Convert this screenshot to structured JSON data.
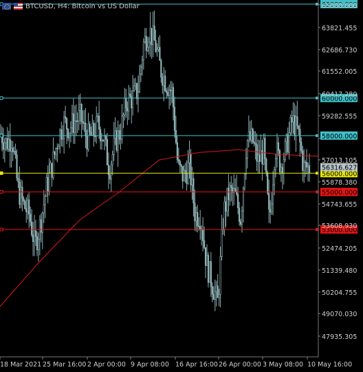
{
  "window": {
    "symbol_title": "BTCUSD, H4:  Bitcoin vs US Dollar",
    "icons": [
      "eu-flag-icon",
      "us-flag-icon"
    ]
  },
  "colors": {
    "background": "#000000",
    "candle": "#8fb2b5",
    "ma": "#d81a1a",
    "cyan_level": "#3fc1c9",
    "yellow_level": "#e8e800",
    "red_level": "#e61515",
    "price_label": "#b8c4c8",
    "axis_text": "#d0d0d0"
  },
  "chart_data": {
    "type": "candlestick",
    "title": "BTCUSD, H4:  Bitcoin vs US Dollar",
    "ylim": [
      46500,
      65000
    ],
    "y_ticks": [
      "65000.000",
      "63821.455",
      "62686.730",
      "61552.005",
      "60417.280",
      "59282.555",
      "58147.830",
      "57013.105",
      "55878.380",
      "54743.655",
      "53608.930",
      "52474.205",
      "51339.480",
      "50204.755",
      "49070.030",
      "47935.305"
    ],
    "x_ticks": [
      "18 Mar 2021",
      "25 Mar 16:00",
      "2 Apr 00:00",
      "9 Apr 08:00",
      "16 Apr 16:00",
      "26 Apr 00:00",
      "3 May 08:00",
      "10 May 16:00"
    ],
    "close_series": [
      {
        "x": "18 Mar 2021",
        "y": 58100
      },
      {
        "x": "19 Mar",
        "y": 57600
      },
      {
        "x": "20 Mar",
        "y": 57900
      },
      {
        "x": "22 Mar",
        "y": 55200
      },
      {
        "x": "23 Mar",
        "y": 54300
      },
      {
        "x": "24 Mar",
        "y": 53800
      },
      {
        "x": "25 Mar 16:00",
        "y": 52100
      },
      {
        "x": "26 Mar",
        "y": 53400
      },
      {
        "x": "27 Mar",
        "y": 55200
      },
      {
        "x": "28 Mar",
        "y": 56400
      },
      {
        "x": "29 Mar",
        "y": 57800
      },
      {
        "x": "30 Mar",
        "y": 58700
      },
      {
        "x": "31 Mar",
        "y": 58400
      },
      {
        "x": "1 Apr",
        "y": 58800
      },
      {
        "x": "2 Apr 00:00",
        "y": 59000
      },
      {
        "x": "3 Apr",
        "y": 57900
      },
      {
        "x": "4 Apr",
        "y": 58000
      },
      {
        "x": "5 Apr",
        "y": 58600
      },
      {
        "x": "6 Apr",
        "y": 57900
      },
      {
        "x": "7 Apr",
        "y": 56200
      },
      {
        "x": "8 Apr",
        "y": 57600
      },
      {
        "x": "9 Apr 08:00",
        "y": 58300
      },
      {
        "x": "10 Apr",
        "y": 59800
      },
      {
        "x": "11 Apr",
        "y": 60000
      },
      {
        "x": "12 Apr",
        "y": 60400
      },
      {
        "x": "13 Apr",
        "y": 62900
      },
      {
        "x": "14 Apr",
        "y": 63600
      },
      {
        "x": "15 Apr",
        "y": 62900
      },
      {
        "x": "16 Apr",
        "y": 61500
      },
      {
        "x": "16 Apr 16:00",
        "y": 60800
      },
      {
        "x": "17 Apr",
        "y": 60300
      },
      {
        "x": "18 Apr",
        "y": 56300
      },
      {
        "x": "19 Apr",
        "y": 55800
      },
      {
        "x": "20 Apr",
        "y": 56400
      },
      {
        "x": "21 Apr",
        "y": 53800
      },
      {
        "x": "22 Apr",
        "y": 53700
      },
      {
        "x": "23 Apr",
        "y": 51200
      },
      {
        "x": "24 Apr",
        "y": 50100
      },
      {
        "x": "25 Apr",
        "y": 49100
      },
      {
        "x": "26 Apr 00:00",
        "y": 53900
      },
      {
        "x": "27 Apr",
        "y": 55000
      },
      {
        "x": "28 Apr",
        "y": 54800
      },
      {
        "x": "29 Apr",
        "y": 53600
      },
      {
        "x": "30 Apr",
        "y": 57700
      },
      {
        "x": "1 May",
        "y": 57800
      },
      {
        "x": "2 May",
        "y": 56600
      },
      {
        "x": "3 May 08:00",
        "y": 57200
      },
      {
        "x": "4 May",
        "y": 53300
      },
      {
        "x": "5 May",
        "y": 57400
      },
      {
        "x": "6 May",
        "y": 56400
      },
      {
        "x": "7 May",
        "y": 57400
      },
      {
        "x": "8 May",
        "y": 58800
      },
      {
        "x": "9 May",
        "y": 58200
      },
      {
        "x": "10 May",
        "y": 56300
      },
      {
        "x": "10 May 16:00",
        "y": 56316.627
      }
    ],
    "moving_average": [
      {
        "x": "18 Mar 2021",
        "y": 48900
      },
      {
        "x": "25 Mar 16:00",
        "y": 51300
      },
      {
        "x": "2 Apr 00:00",
        "y": 53500
      },
      {
        "x": "9 Apr 08:00",
        "y": 55000
      },
      {
        "x": "16 Apr 16:00",
        "y": 56700
      },
      {
        "x": "20 Apr",
        "y": 57100
      },
      {
        "x": "26 Apr 00:00",
        "y": 57250
      },
      {
        "x": "3 May 08:00",
        "y": 57000
      },
      {
        "x": "10 May 16:00",
        "y": 56900
      }
    ],
    "levels": [
      {
        "price": 65000,
        "label": "65000.000",
        "color": "cyan"
      },
      {
        "price": 60000,
        "label": "60000.000",
        "color": "cyan"
      },
      {
        "price": 58000,
        "label": "58000.000",
        "color": "cyan"
      },
      {
        "price": 56000,
        "label": "56000.000",
        "color": "yellow"
      },
      {
        "price": 55000,
        "label": "55000.000",
        "color": "red"
      },
      {
        "price": 53000,
        "label": "53000.000",
        "color": "red"
      }
    ],
    "current_price": {
      "price": 56316.627,
      "label": "56316.627"
    }
  }
}
